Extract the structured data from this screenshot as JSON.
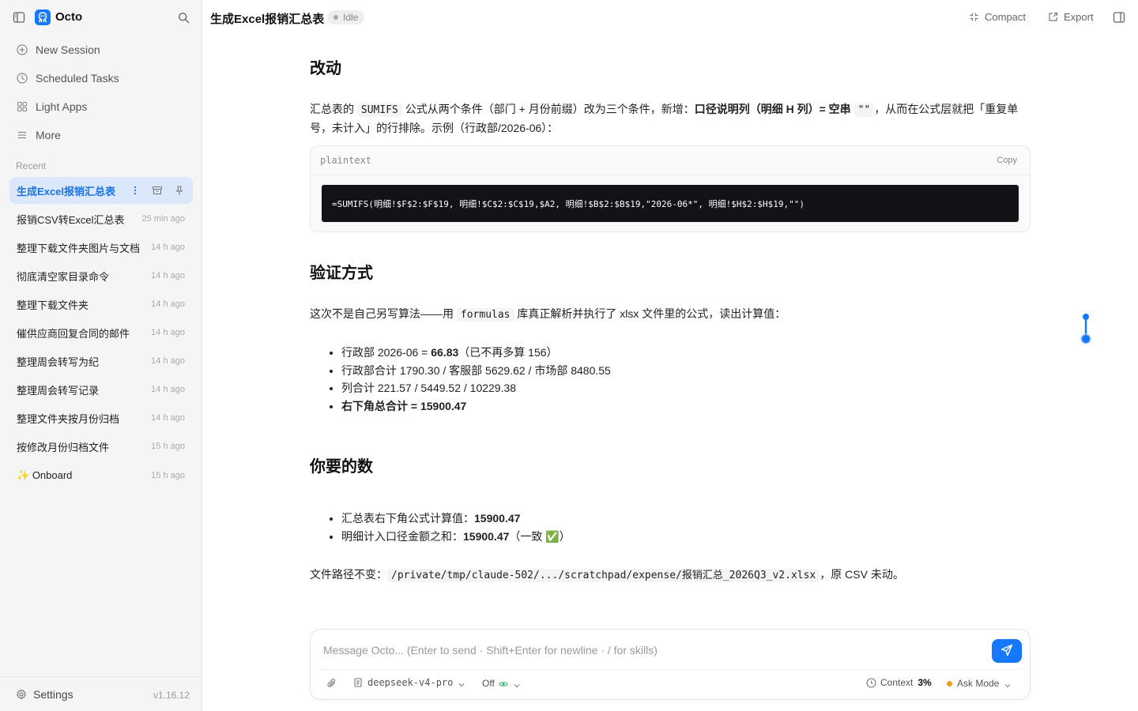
{
  "app": {
    "name": "Octo",
    "version": "v1.16.12",
    "brand_color": "#1677ff"
  },
  "sidebar": {
    "nav": [
      {
        "label": "New Session",
        "icon": "plus-circle-icon"
      },
      {
        "label": "Scheduled Tasks",
        "icon": "clock-icon"
      },
      {
        "label": "Light Apps",
        "icon": "grid-icon"
      },
      {
        "label": "More",
        "icon": "menu-icon"
      }
    ],
    "recent_label": "Recent",
    "sessions": [
      {
        "title": "生成Excel报销汇总表",
        "time": "",
        "active": true
      },
      {
        "title": "报销CSV转Excel汇总表",
        "time": "25 min ago"
      },
      {
        "title": "整理下载文件夹图片与文档",
        "time": "14 h ago"
      },
      {
        "title": "彻底清空家目录命令",
        "time": "14 h ago"
      },
      {
        "title": "整理下载文件夹",
        "time": "14 h ago"
      },
      {
        "title": "催供应商回复合同的邮件",
        "time": "14 h ago"
      },
      {
        "title": "整理周会转写为纪",
        "time": "14 h ago"
      },
      {
        "title": "整理周会转写记录",
        "time": "14 h ago"
      },
      {
        "title": "整理文件夹按月份归档",
        "time": "14 h ago"
      },
      {
        "title": "按修改月份归档文件",
        "time": "15 h ago"
      },
      {
        "title": "Onboard",
        "time": "15 h ago",
        "emoji": "✨"
      }
    ],
    "settings_label": "Settings"
  },
  "header": {
    "title": "生成Excel报销汇总表",
    "status": "Idle",
    "compact_label": "Compact",
    "export_label": "Export"
  },
  "content": {
    "sec1_title": "改动",
    "sec1_p_a": "汇总表的",
    "sec1_p_code": "SUMIFS",
    "sec1_p_b": "公式从两个条件（部门 + 月份前缀）改为三个条件，新增：",
    "sec1_p_bold": "口径说明列（明细 H 列）= 空串",
    "sec1_p_code2": "\"\"",
    "sec1_p_c": "，从而在公式层就把「重复单号，未计入」的行排除。示例（行政部/2026-06）：",
    "code_lang": "plaintext",
    "copy_label": "Copy",
    "code_text": "=SUMIFS(明细!$F$2:$F$19, 明细!$C$2:$C$19,$A2, 明细!$B$2:$B$19,\"2026-06*\", 明细!$H$2:$H$19,\"\")",
    "sec2_title": "验证方式",
    "sec2_p_a": "这次不是自己另写算法——用",
    "sec2_p_code": "formulas",
    "sec2_p_b": "库真正解析并执行了 xlsx 文件里的公式，读出计算值：",
    "sec2_b1_a": "行政部 2026-06 = ",
    "sec2_b1_bold": "66.83",
    "sec2_b1_b": "（已不再多算 156）",
    "sec2_b2": "行政部合计 1790.30 / 客服部 5629.62 / 市场部 8480.55",
    "sec2_b3": "列合计 221.57 / 5449.52 / 10229.38",
    "sec2_b4": "右下角总合计 = 15900.47",
    "sec3_title": "你要的数",
    "sec3_b1_a": "汇总表右下角公式计算值：",
    "sec3_b1_bold": "15900.47",
    "sec3_b2_a": "明细计入口径金额之和：",
    "sec3_b2_bold": "15900.47",
    "sec3_b2_b": "（一致 ✅）",
    "path_a": "文件路径不变：",
    "path_code": "/private/tmp/claude-502/.../scratchpad/expense/报销汇总_2026Q3_v2.xlsx",
    "path_b": "，原 CSV 未动。"
  },
  "composer": {
    "placeholder": "Message Octo... (Enter to send · Shift+Enter for newline · / for skills)",
    "model": "deepseek-v4-pro",
    "thinking": "Off",
    "context_label": "Context",
    "context_value": "3%",
    "mode": "Ask Mode"
  }
}
